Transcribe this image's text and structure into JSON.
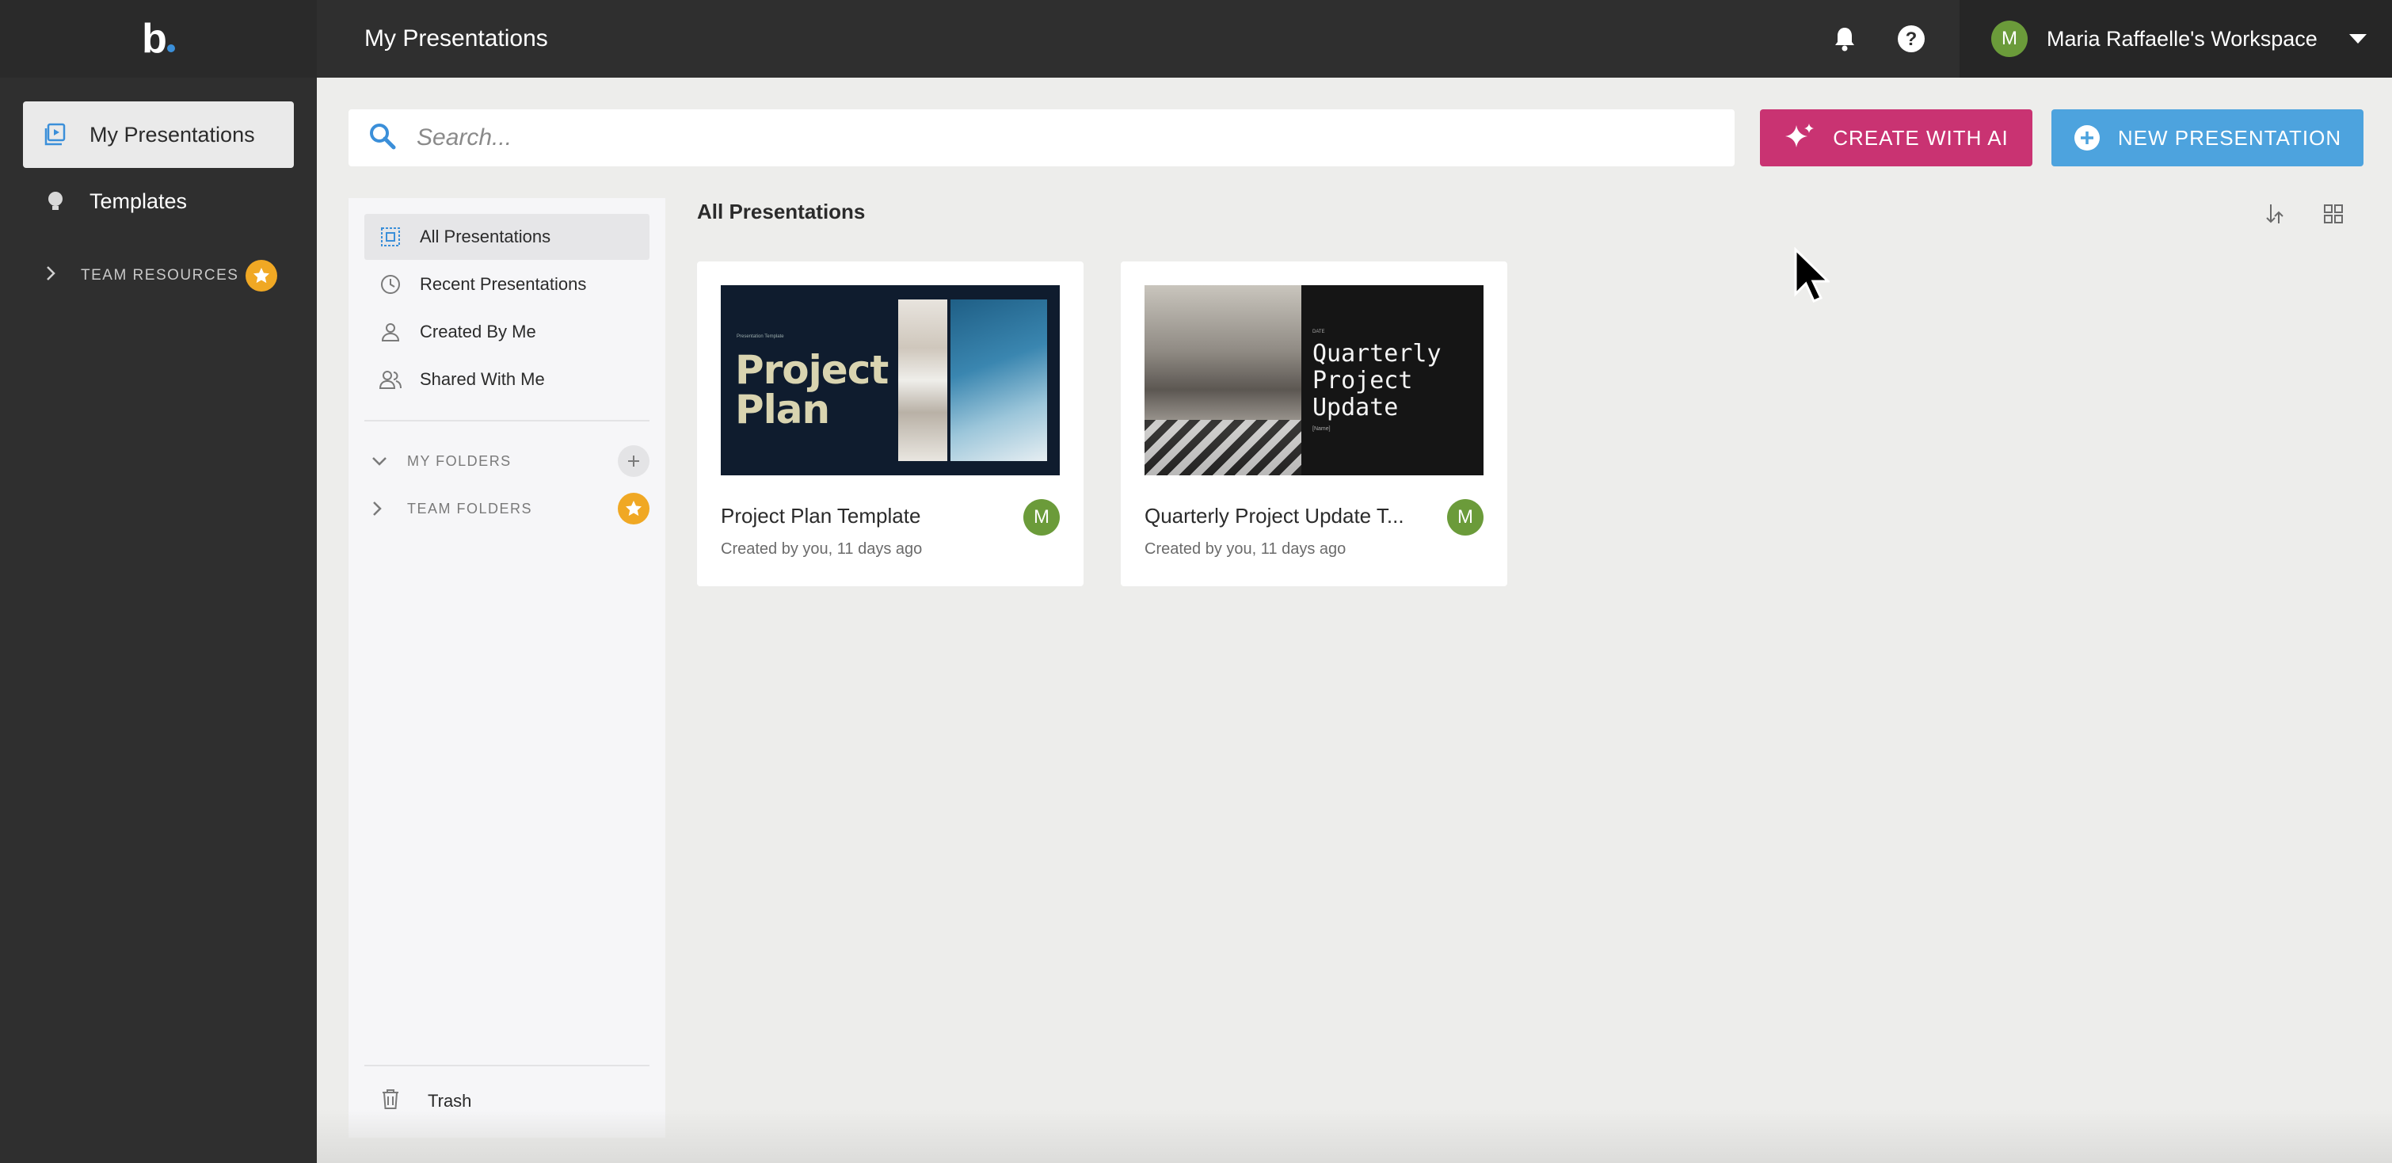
{
  "app": {
    "logo_text": "b",
    "page_title": "My Presentations"
  },
  "sidebar": {
    "items": [
      {
        "label": "My Presentations",
        "icon": "presentation-icon",
        "active": true
      },
      {
        "label": "Templates",
        "icon": "lightbulb-icon",
        "active": false
      }
    ],
    "team_resources_label": "TEAM RESOURCES"
  },
  "header": {
    "workspace_label": "Maria Raffaelle's Workspace",
    "avatar_initial": "M",
    "icons": [
      "bell-icon",
      "help-icon"
    ]
  },
  "search": {
    "placeholder": "Search..."
  },
  "actions": {
    "create_ai_label": "CREATE WITH AI",
    "new_presentation_label": "NEW PRESENTATION"
  },
  "folders": {
    "filters": [
      {
        "label": "All Presentations",
        "icon": "all-presentations-icon",
        "active": true
      },
      {
        "label": "Recent Presentations",
        "icon": "clock-icon",
        "active": false
      },
      {
        "label": "Created By Me",
        "icon": "user-icon",
        "active": false
      },
      {
        "label": "Shared With Me",
        "icon": "users-icon",
        "active": false
      }
    ],
    "my_folders_label": "MY FOLDERS",
    "team_folders_label": "TEAM FOLDERS",
    "trash_label": "Trash"
  },
  "main": {
    "section_title": "All Presentations",
    "cards": [
      {
        "title": "Project Plan Template",
        "meta": "Created by you, 11 days ago",
        "owner_initial": "M",
        "thumb_small": "Presentation Template",
        "thumb_big": "Project Plan"
      },
      {
        "title": "Quarterly Project Update T...",
        "meta": "Created by you, 11 days ago",
        "owner_initial": "M",
        "thumb_date": "DATE",
        "thumb_big": "Quarterly Project Update",
        "thumb_name": "[Name]"
      }
    ]
  },
  "colors": {
    "sidebar_bg": "#2f2f2f",
    "accent_ai": "#c93372",
    "accent_new": "#4da3de",
    "avatar_green": "#6b9b3a",
    "star_badge": "#f0a824"
  }
}
